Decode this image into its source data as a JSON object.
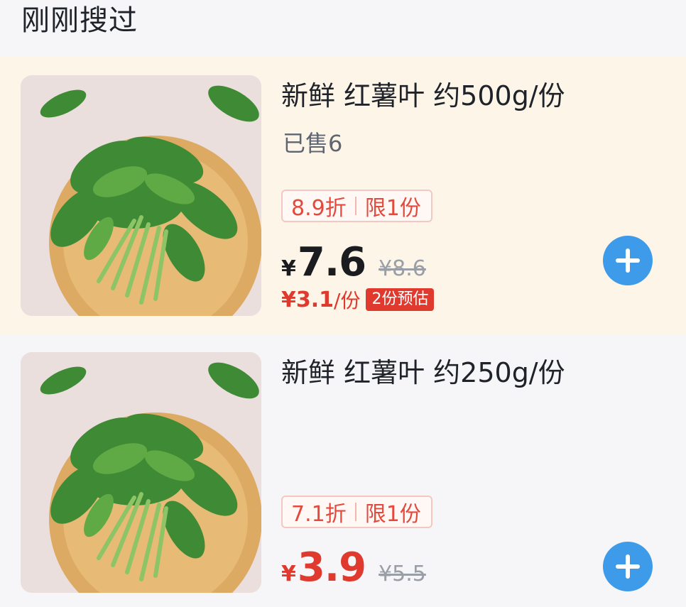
{
  "section": {
    "title": "刚刚搜过"
  },
  "products": [
    {
      "name": "新鲜 红薯叶 约500g/份",
      "sold": "已售6",
      "discount": "8.9折",
      "limit": "限1份",
      "currency": "¥",
      "price": "7.6",
      "original_price": "¥8.6",
      "unit_price": "¥3.1",
      "unit_suffix": "/份",
      "estimate_badge": "2份预估",
      "image": "sweet-potato-leaves-photo",
      "add_icon": "plus-icon"
    },
    {
      "name": "新鲜 红薯叶 约250g/份",
      "discount": "7.1折",
      "limit": "限1份",
      "currency": "¥",
      "price": "3.9",
      "original_price": "¥5.5",
      "image": "sweet-potato-leaves-photo",
      "add_icon": "plus-icon"
    }
  ],
  "colors": {
    "page_background": "#f6f6f8",
    "highlight_background": "#fdf6e8",
    "accent_red": "#e0392e",
    "add_button_blue": "#3d9be9",
    "text_primary": "#1f2329"
  }
}
